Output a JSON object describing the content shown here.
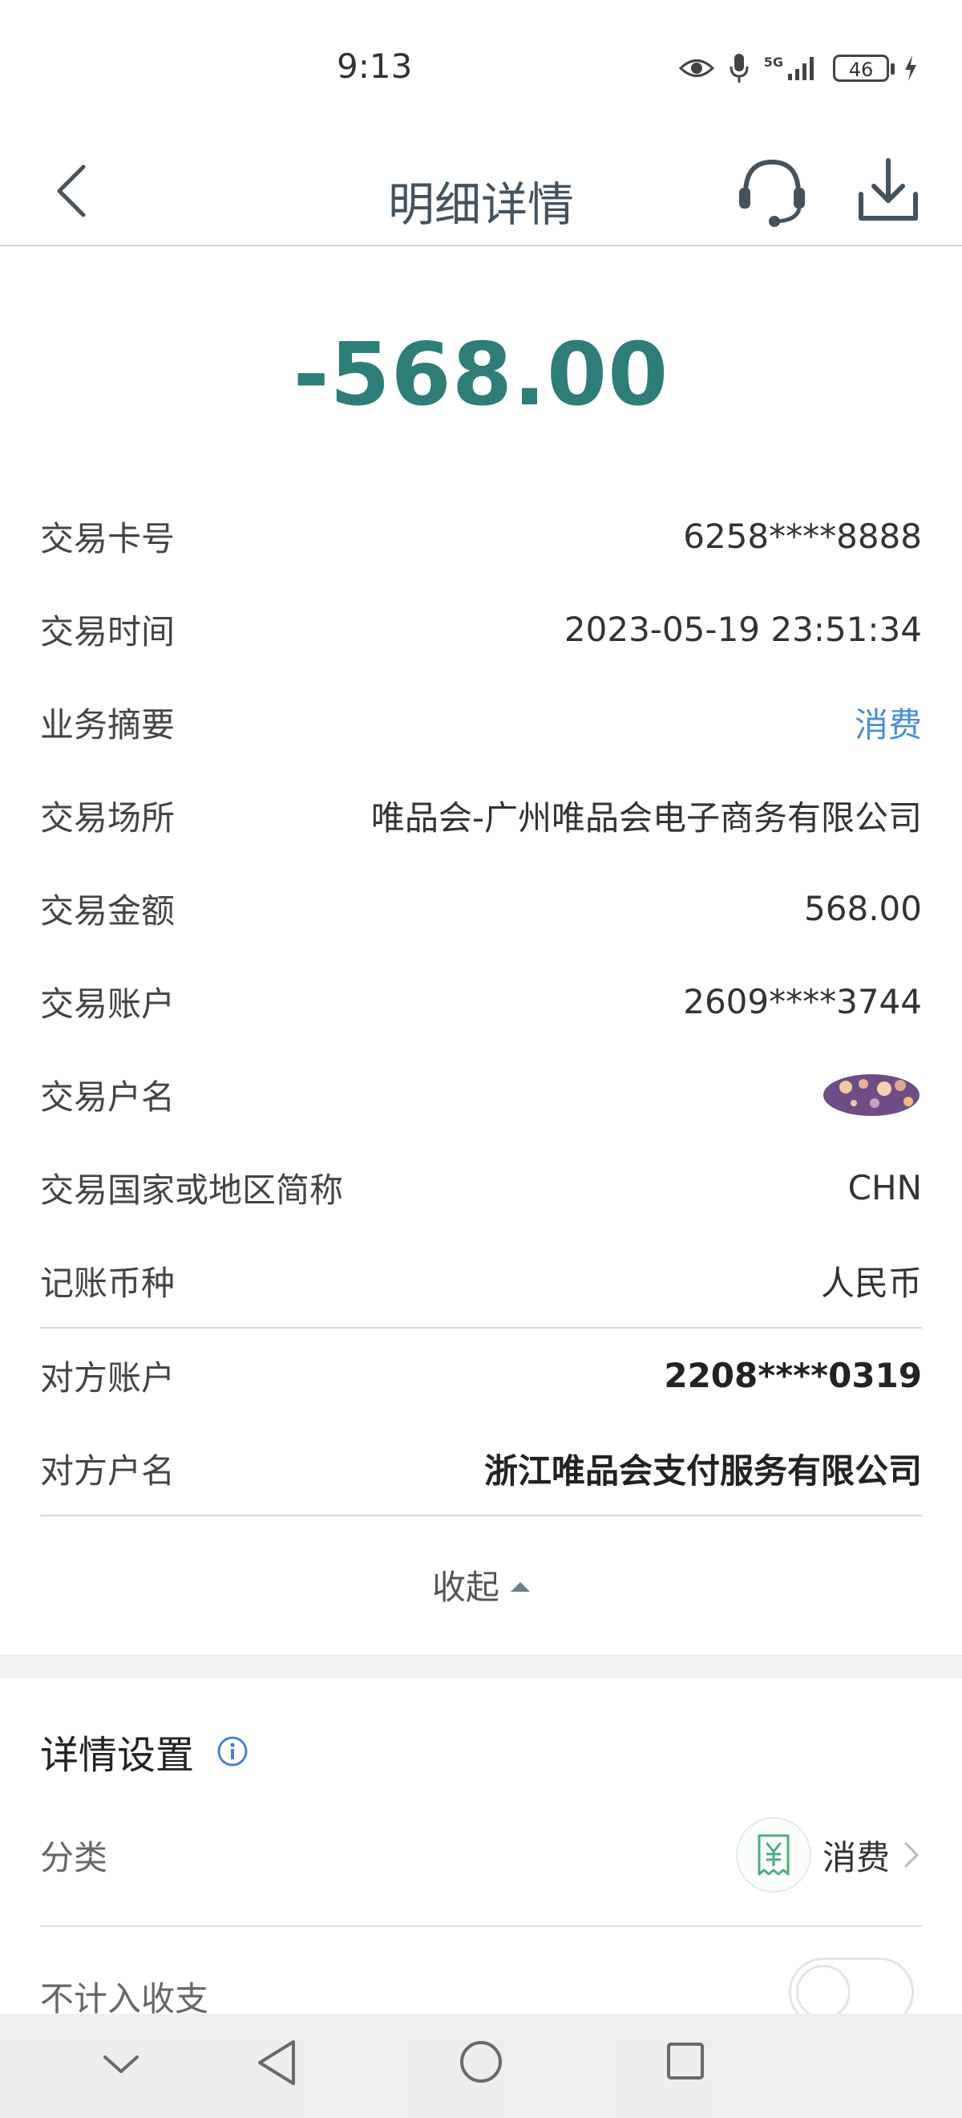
{
  "status_bar": {
    "time": "9:13",
    "network": "5G",
    "battery": "46",
    "icons": [
      "eye-icon",
      "mic-icon",
      "signal-icon",
      "battery-icon",
      "charging-icon"
    ]
  },
  "nav": {
    "title": "明细详情",
    "icons": [
      "back-icon",
      "customer-service-icon",
      "download-icon"
    ]
  },
  "amount": "-568.00",
  "details": [
    {
      "label": "交易卡号",
      "value": "6258****8888"
    },
    {
      "label": "交易时间",
      "value": "2023-05-19 23:51:34"
    },
    {
      "label": "业务摘要",
      "value": "消费"
    },
    {
      "label": "交易场所",
      "value": "唯品会-广州唯品会电子商务有限公司"
    },
    {
      "label": "交易金额",
      "value": "568.00"
    },
    {
      "label": "交易账户",
      "value": "2609****3744"
    },
    {
      "label": "交易户名",
      "value": ""
    },
    {
      "label": "交易国家或地区简称",
      "value": "CHN"
    },
    {
      "label": "记账币种",
      "value": "人民币"
    }
  ],
  "counterparty": [
    {
      "label": "对方账户",
      "value": "2208****0319"
    },
    {
      "label": "对方户名",
      "value": "浙江唯品会支付服务有限公司"
    }
  ],
  "collapse_label": "收起",
  "settings": {
    "title": "详情设置",
    "category_label": "分类",
    "category_icon": "yuan-receipt-icon",
    "category_value": "消费",
    "exclude_label": "不计入收支",
    "exclude_on": false
  },
  "colors": {
    "amount": "#2e7d78",
    "link": "#4a8fd6",
    "title": "#44535e"
  }
}
